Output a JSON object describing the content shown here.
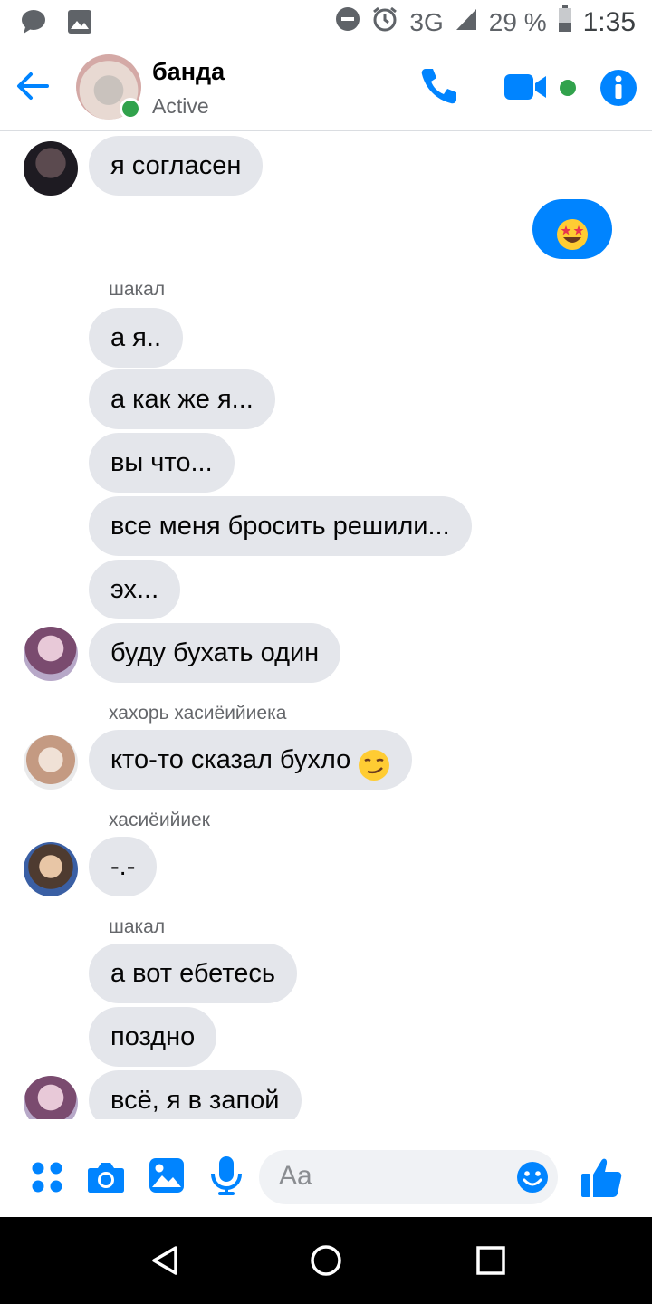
{
  "status_bar": {
    "network": "3G",
    "battery_percent": "29 %",
    "time": "1:35"
  },
  "header": {
    "title": "банда",
    "subtitle": "Active"
  },
  "messages": [
    {
      "text": "я согласен"
    },
    {
      "sender": "шакал",
      "texts": [
        "а я..",
        "а как же я...",
        "вы что...",
        "все меня бросить решили...",
        "эх...",
        "буду бухать один"
      ]
    },
    {
      "sender": "хахорь хасиёийиека",
      "text": "кто-то сказал бухло"
    },
    {
      "sender": "хасиёийиек",
      "text": "-.-"
    },
    {
      "sender": "шакал",
      "texts": [
        "а вот ебетесь",
        "поздно",
        "всё, я в запой"
      ]
    }
  ],
  "composer": {
    "placeholder": "Aa"
  },
  "colors": {
    "accent": "#0084ff",
    "bubble_gray": "#e4e6eb",
    "active_green": "#31a24c"
  }
}
